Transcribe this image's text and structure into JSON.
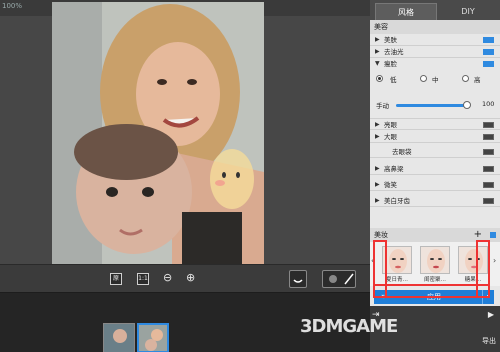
{
  "canvas": {
    "zoom_text": "100%"
  },
  "toolbar": {
    "fit_label": "1:1",
    "original_label": "原",
    "zoom_out_icon": "zoom-out-icon",
    "zoom_in_icon": "zoom-in-icon"
  },
  "panel": {
    "tabs": [
      {
        "label": "风格"
      },
      {
        "label": "DIY"
      }
    ],
    "beauty_title": "美容",
    "items": [
      {
        "label": "美肤",
        "state": "on"
      },
      {
        "label": "去油光",
        "state": "on"
      },
      {
        "label": "瘦脸",
        "state": "on"
      },
      {
        "label": "亮眼",
        "state": "off"
      },
      {
        "label": "大眼",
        "state": "off"
      },
      {
        "label": "去眼袋",
        "state": "off"
      },
      {
        "label": "高鼻梁",
        "state": "off"
      },
      {
        "label": "微笑",
        "state": "off"
      },
      {
        "label": "美白牙齿",
        "state": "off"
      }
    ],
    "slim_options": [
      "低",
      "中",
      "高"
    ],
    "slim_selected": "低",
    "manual_label": "手动",
    "manual_value": "100",
    "manual_fraction": 1.0,
    "makeup_title": "美妆",
    "makeup_add": "+",
    "makeup_items": [
      {
        "label": "夏日青…"
      },
      {
        "label": "闺密聚…"
      },
      {
        "label": "糖果…"
      }
    ],
    "apply_label": "应用",
    "export_label": "导出"
  },
  "colors": {
    "accent": "#2f8ae0",
    "highlight_box": "#e33333"
  },
  "watermark": "3DMGAME"
}
